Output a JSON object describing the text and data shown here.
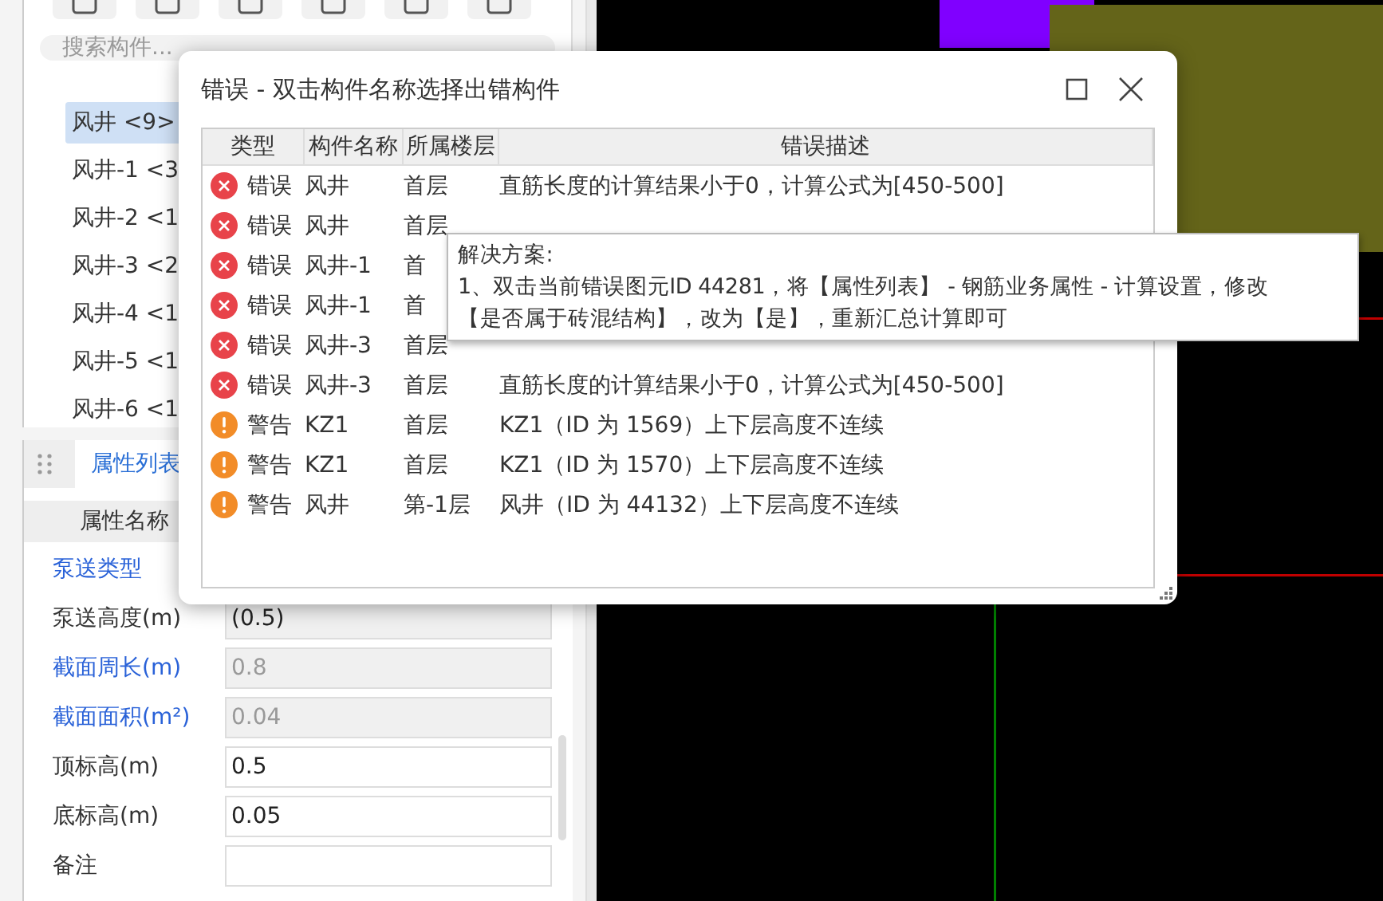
{
  "search": {
    "placeholder": "搜索构件..."
  },
  "components": [
    {
      "label": "风井 <9>",
      "selected": true
    },
    {
      "label": "风井-1 <3",
      "selected": false
    },
    {
      "label": "风井-2 <1",
      "selected": false
    },
    {
      "label": "风井-3 <2",
      "selected": false
    },
    {
      "label": "风井-4 <1",
      "selected": false
    },
    {
      "label": "风井-5 <1",
      "selected": false
    },
    {
      "label": "风井-6 <1",
      "selected": false
    }
  ],
  "property_panel": {
    "tab": {
      "label": "属性列表",
      "selected": true
    },
    "header": "属性名称",
    "rows": [
      {
        "name": "泵送类型",
        "highlighted": true
      },
      {
        "name": "泵送高度(m)",
        "highlighted": false,
        "kind": "readonly",
        "value": "(0.5)"
      },
      {
        "name": "截面周长(m)",
        "highlighted": true,
        "kind": "disabled",
        "value": "0.8"
      },
      {
        "name": "截面面积(m²)",
        "highlighted": true,
        "kind": "disabled",
        "value": "0.04"
      },
      {
        "name": "顶标高(m)",
        "highlighted": false,
        "kind": "editable",
        "value": "0.5"
      },
      {
        "name": "底标高(m)",
        "highlighted": false,
        "kind": "editable",
        "value": "0.05"
      },
      {
        "name": "备注",
        "highlighted": false,
        "kind": "editable"
      }
    ]
  },
  "dialog": {
    "title": "错误 - 双击构件名称选择出错构件",
    "columns": [
      "类型",
      "构件名称",
      "所属楼层",
      "错误描述"
    ],
    "rows": [
      {
        "kind": "error",
        "type": "错误",
        "name": "风井",
        "floor": "首层",
        "description": "直筋长度的计算结果小于0，计算公式为[450-500]"
      },
      {
        "kind": "error",
        "type": "错误",
        "name": "风井",
        "floor": "首层"
      },
      {
        "kind": "error",
        "type": "错误",
        "name": "风井-1",
        "floor": "首"
      },
      {
        "kind": "error",
        "type": "错误",
        "name": "风井-1",
        "floor": "首"
      },
      {
        "kind": "error",
        "type": "错误",
        "name": "风井-3",
        "floor": "首层"
      },
      {
        "kind": "error",
        "type": "错误",
        "name": "风井-3",
        "floor": "首层",
        "description": "直筋长度的计算结果小于0，计算公式为[450-500]"
      },
      {
        "kind": "warning",
        "type": "警告",
        "name": "KZ1",
        "floor": "首层",
        "description": "KZ1（ID 为 1569）上下层高度不连续"
      },
      {
        "kind": "warning",
        "type": "警告",
        "name": "KZ1",
        "floor": "首层",
        "description": "KZ1（ID 为 1570）上下层高度不连续"
      },
      {
        "kind": "warning",
        "type": "警告",
        "name": "风井",
        "floor": "第-1层",
        "description": "风井（ID 为 44132）上下层高度不连续"
      }
    ]
  },
  "tooltip": {
    "lines": [
      "解决方案:",
      "1、双击当前错误图元ID 44281，将【属性列表】 - 钢筋业务属性 - 计算设置，修改",
      "【是否属于砖混结构】，改为【是】，重新汇总计算即可"
    ]
  }
}
